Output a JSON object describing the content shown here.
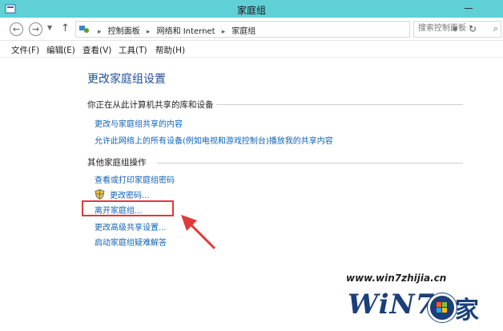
{
  "window": {
    "title": "家庭组"
  },
  "address": {
    "breadcrumbs": [
      "控制面板",
      "网络和 Internet",
      "家庭组"
    ],
    "search_placeholder": "搜索控制面板"
  },
  "menu": [
    "文件(F)",
    "编辑(E)",
    "查看(V)",
    "工具(T)",
    "帮助(H)"
  ],
  "page": {
    "title": "更改家庭组设置",
    "section1": {
      "heading": "你正在从此计算机共享的库和设备",
      "links": [
        "更改与家庭组共享的内容",
        "允许此网络上的所有设备(例如电视和游戏控制台)播放我的共享内容"
      ]
    },
    "section2": {
      "heading": "其他家庭组操作",
      "links": [
        "查看或打印家庭组密码",
        "更改密码...",
        "离开家庭组...",
        "更改高级共享设置...",
        "启动家庭组疑难解答"
      ]
    }
  },
  "annotation": {
    "highlight_color": "#e03a3a"
  },
  "watermark": {
    "url": "www.win7zhijia.cn",
    "logo": "WiN7",
    "suffix": "家"
  }
}
